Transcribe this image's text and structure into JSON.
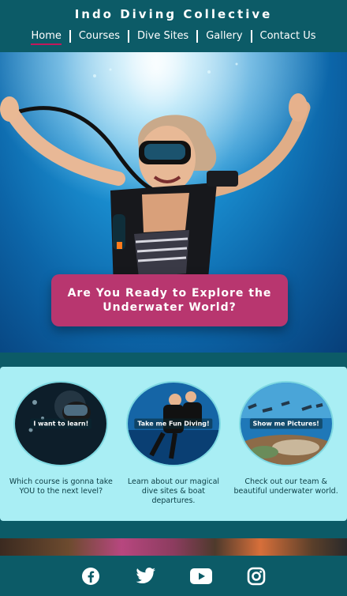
{
  "header": {
    "title": "Indo Diving Collective",
    "nav": [
      {
        "label": "Home",
        "active": true
      },
      {
        "label": "Courses",
        "active": false
      },
      {
        "label": "Dive Sites",
        "active": false
      },
      {
        "label": "Gallery",
        "active": false
      },
      {
        "label": "Contact Us",
        "active": false
      }
    ]
  },
  "hero": {
    "cta": "Are You Ready to Explore the Underwater World?"
  },
  "cards": [
    {
      "button": "I want to learn!",
      "text": "Which course is gonna take YOU to the next level?"
    },
    {
      "button": "Take me Fun Diving!",
      "text": "Learn about our magical dive sites & boat departures."
    },
    {
      "button": "Show me Pictures!",
      "text": "Check out our team & beautiful underwater world."
    }
  ],
  "footer": {
    "socials": [
      "facebook-icon",
      "twitter-icon",
      "youtube-icon",
      "instagram-icon"
    ]
  },
  "colors": {
    "header_bg": "#0c5b67",
    "accent": "#b8366f",
    "cards_bg": "#a9eef4"
  }
}
